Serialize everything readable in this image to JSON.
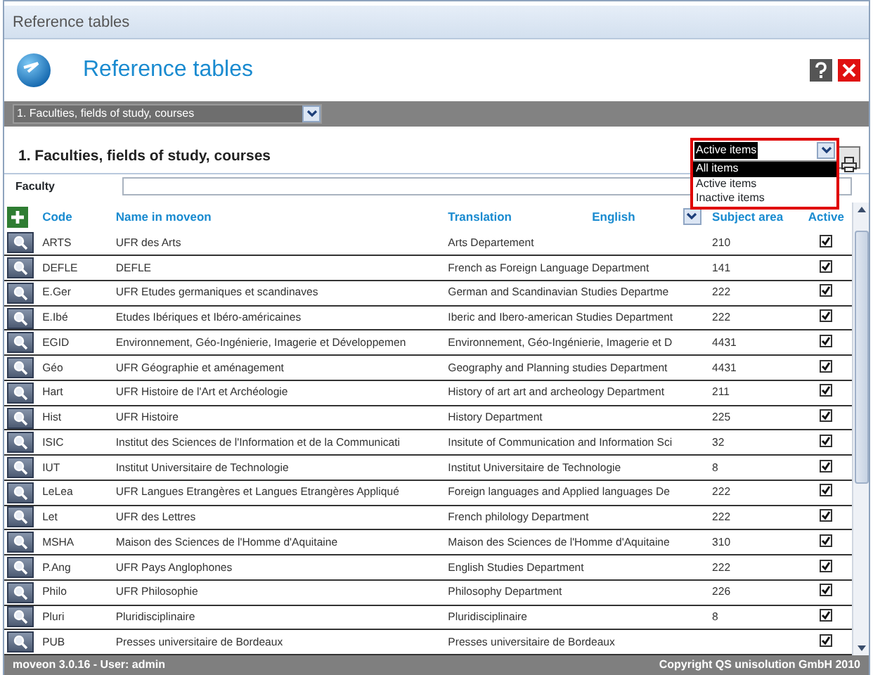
{
  "window": {
    "title": "Reference tables"
  },
  "header": {
    "title": "Reference tables"
  },
  "table_selector": {
    "value": "1. Faculties, fields of study, courses"
  },
  "section_title": "1. Faculties, fields of study, courses",
  "status_filter": {
    "value": "Active items",
    "options": [
      {
        "label": "All items",
        "highlighted": true
      },
      {
        "label": "Active items",
        "highlighted": false
      },
      {
        "label": "Inactive items",
        "highlighted": false
      }
    ]
  },
  "filter": {
    "label": "Faculty"
  },
  "columns": [
    "Code",
    "Name in moveon",
    "Translation",
    "Subject area",
    "Active"
  ],
  "language_select": {
    "value": "English"
  },
  "rows": [
    {
      "code": "ARTS",
      "name": "UFR des Arts",
      "translation": "Arts Departement",
      "subject_area": "210",
      "active": true
    },
    {
      "code": "DEFLE",
      "name": "DEFLE",
      "translation": "French as Foreign Language Department",
      "subject_area": "141",
      "active": true
    },
    {
      "code": "E.Ger",
      "name": "UFR Etudes germaniques et scandinaves",
      "translation": "German and Scandinavian Studies Departme",
      "subject_area": "222",
      "active": true
    },
    {
      "code": "E.Ibé",
      "name": "Etudes Ibériques et Ibéro-américaines",
      "translation": "Iberic and Ibero-american Studies Department",
      "subject_area": "222",
      "active": true
    },
    {
      "code": "EGID",
      "name": "Environnement, Géo-Ingénierie, Imagerie et Développemen",
      "translation": "Environnement, Géo-Ingénierie, Imagerie et D",
      "subject_area": "4431",
      "active": true
    },
    {
      "code": "Géo",
      "name": "UFR Géographie et aménagement",
      "translation": "Geography and Planning studies Department",
      "subject_area": "4431",
      "active": true
    },
    {
      "code": "Hart",
      "name": "UFR Histoire de l'Art et Archéologie",
      "translation": "History of art art and archeology Department",
      "subject_area": "211",
      "active": true
    },
    {
      "code": "Hist",
      "name": "UFR Histoire",
      "translation": "History Department",
      "subject_area": "225",
      "active": true
    },
    {
      "code": "ISIC",
      "name": "Institut des Sciences de l'Information et de la Communicati",
      "translation": "Insitute of Communication and Information Sci",
      "subject_area": "32",
      "active": true
    },
    {
      "code": "IUT",
      "name": "Institut Universitaire de Technologie",
      "translation": "Institut Universitaire de Technologie",
      "subject_area": "8",
      "active": true
    },
    {
      "code": "LeLea",
      "name": "UFR Langues Etrangères et Langues Etrangères Appliqué",
      "translation": "Foreign languages and Applied languages De",
      "subject_area": "222",
      "active": true
    },
    {
      "code": "Let",
      "name": "UFR des Lettres",
      "translation": "French philology Department",
      "subject_area": "222",
      "active": true
    },
    {
      "code": "MSHA",
      "name": "Maison des Sciences de l'Homme d'Aquitaine",
      "translation": "Maison des Sciences de l'Homme d'Aquitaine",
      "subject_area": "310",
      "active": true
    },
    {
      "code": "P.Ang",
      "name": "UFR Pays Anglophones",
      "translation": "English Studies Department",
      "subject_area": "222",
      "active": true
    },
    {
      "code": "Philo",
      "name": "UFR Philosophie",
      "translation": "Philosophy Department",
      "subject_area": "226",
      "active": true
    },
    {
      "code": "Pluri",
      "name": "Pluridisciplinaire",
      "translation": "Pluridisciplinaire",
      "subject_area": "8",
      "active": true
    },
    {
      "code": "PUB",
      "name": "Presses universitaire de Bordeaux",
      "translation": "Presses universitaire de Bordeaux",
      "active": true
    }
  ],
  "status_bar": {
    "left": "moveon 3.0.16 - User: admin",
    "right": "Copyright QS unisolution GmbH 2010"
  }
}
